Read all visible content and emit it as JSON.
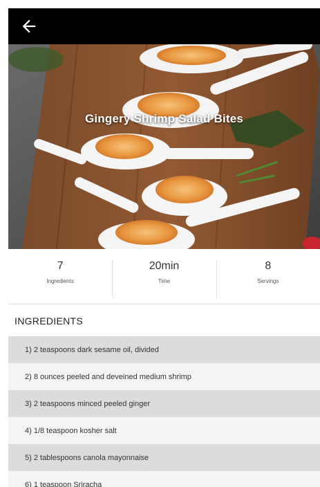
{
  "header": {
    "back_icon": "arrow-left-icon"
  },
  "recipe": {
    "title": "Gingery Shrimp Salad Bites"
  },
  "stats": [
    {
      "value": "7",
      "label": "Ingredients"
    },
    {
      "value": "20min",
      "label": "Time"
    },
    {
      "value": "8",
      "label": "Servings"
    }
  ],
  "ingredients_section": {
    "title": "INGREDIENTS",
    "items": [
      "1) 2 teaspoons dark sesame oil, divided",
      "2) 8 ounces peeled and deveined medium shrimp",
      "3) 2 teaspoons minced peeled ginger",
      "4) 1/8 teaspoon kosher salt",
      "5) 2 tablespoons canola mayonnaise",
      "6) 1 teaspoon Sriracha"
    ]
  },
  "colors": {
    "appbar": "#000000",
    "row_dark": "#dcdcdc",
    "row_light": "#f5f5f5"
  }
}
